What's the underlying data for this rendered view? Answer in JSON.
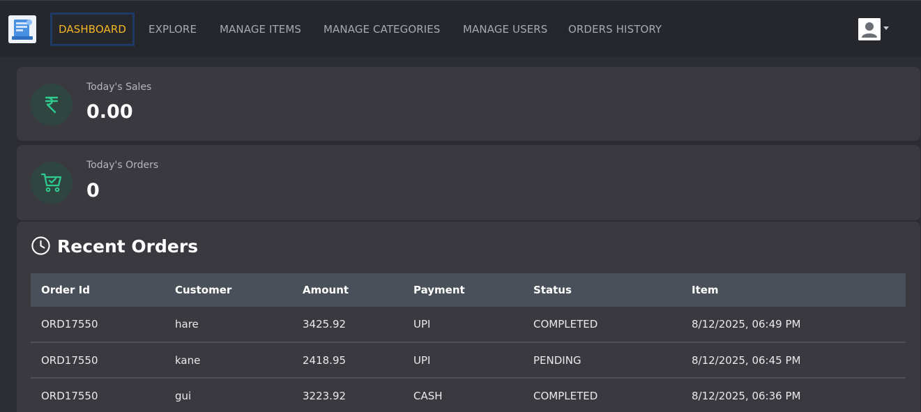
{
  "nav": {
    "items": [
      {
        "label": "DASHBOARD",
        "active": true
      },
      {
        "label": "EXPLORE",
        "active": false
      },
      {
        "label": "MANAGE ITEMS",
        "active": false
      },
      {
        "label": "MANAGE CATEGORIES",
        "active": false
      },
      {
        "label": "MANAGE USERS",
        "active": false
      },
      {
        "label": "ORDERS HISTORY",
        "active": false
      }
    ]
  },
  "stats": {
    "sales": {
      "label": "Today's Sales",
      "value": "0.00",
      "icon": "rupee-icon"
    },
    "orders": {
      "label": "Today's Orders",
      "value": "0",
      "icon": "cart-check-icon"
    }
  },
  "recent_orders": {
    "title": "Recent Orders",
    "icon": "clock-icon",
    "columns": [
      "Order Id",
      "Customer",
      "Amount",
      "Payment",
      "Status",
      "Item"
    ],
    "rows": [
      [
        "ORD17550",
        "hare",
        "3425.92",
        "UPI",
        "COMPLETED",
        "8/12/2025, 06:49 PM"
      ],
      [
        "ORD17550",
        "kane",
        "2418.95",
        "UPI",
        "PENDING",
        "8/12/2025, 06:45 PM"
      ],
      [
        "ORD17550",
        "gui",
        "3223.92",
        "CASH",
        "COMPLETED",
        "8/12/2025, 06:36 PM"
      ]
    ]
  },
  "colors": {
    "accent": "#f5b623",
    "icon_green": "#2ecc8f",
    "background": "#2b2d33",
    "card": "#3a393f",
    "table_header": "#4a5059"
  }
}
